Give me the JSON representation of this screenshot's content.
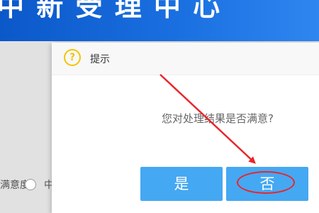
{
  "banner": {
    "title": "中 新 受 理 中 心"
  },
  "background": {
    "form_label": "满意度：",
    "radio_option": "中"
  },
  "dialog": {
    "title": "提示",
    "icon": "question-circle-icon",
    "message": "您对处理结果是否满意?",
    "yes_label": "是",
    "no_label": "否"
  },
  "annotation": {
    "color": "#e8262c"
  }
}
